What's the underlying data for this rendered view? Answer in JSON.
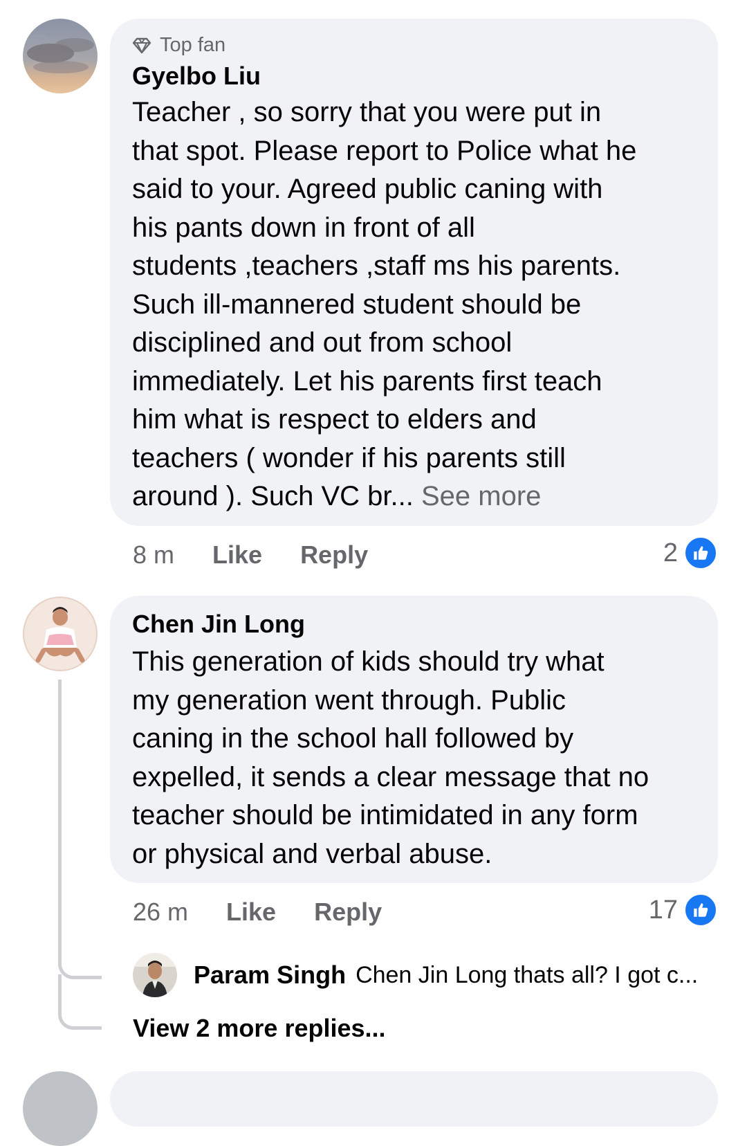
{
  "comments": [
    {
      "badge": "Top fan",
      "author": "Gyelbo Liu",
      "text": "Teacher , so sorry that you were put in\nthat spot. Please report to Police what he\nsaid to your. Agreed public caning with\nhis pants down in front of all\nstudents ,teachers ,staff ms his parents.\nSuch ill-mannered student should be\ndisciplined and out from school\nimmediately. Let his parents first teach\nhim what is respect to elders and\nteachers ( wonder if  his parents still\naround ). Such VC br... ",
      "see_more": "See more",
      "time": "8 m",
      "like_label": "Like",
      "reply_label": "Reply",
      "reaction_count": "2"
    },
    {
      "author": "Chen Jin Long",
      "text": "This generation of kids should try what\nmy generation went through. Public\ncaning in the school hall followed by\nexpelled, it sends a clear message that no\nteacher should be intimidated in any form\nor physical and verbal abuse.",
      "time": "26 m",
      "like_label": "Like",
      "reply_label": "Reply",
      "reaction_count": "17"
    }
  ],
  "reply_preview": {
    "author": "Param Singh",
    "text": "Chen Jin Long thats all? I got c..."
  },
  "view_more_replies": "View 2 more replies...",
  "colors": {
    "bubble": "#f0f2f5",
    "secondary_text": "#65676b",
    "like_blue": "#1877f2",
    "thread_line": "#ced0d4"
  },
  "icons": [
    "diamond-icon",
    "thumbs-up-icon"
  ]
}
